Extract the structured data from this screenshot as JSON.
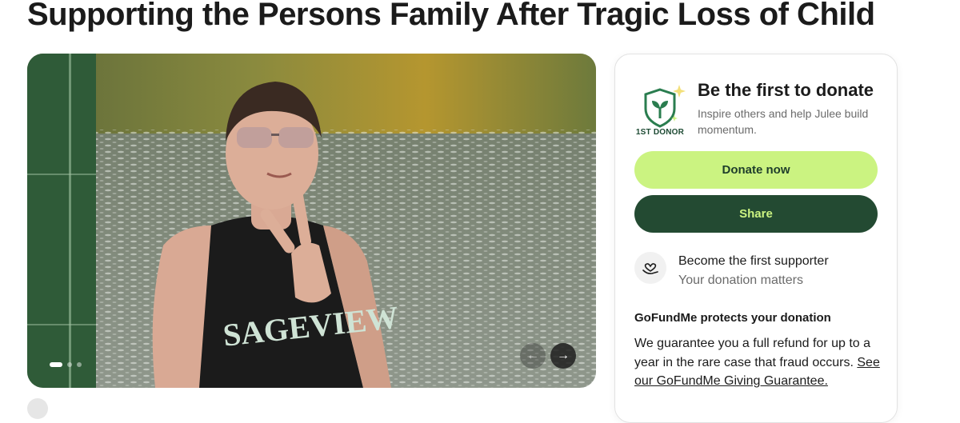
{
  "page": {
    "title": "Supporting the Persons Family After Tragic Loss of Child"
  },
  "hero": {
    "image_alt": "Teen in a SAGEVIEW tank top giving a peace sign by a river",
    "shirt_text": "SAGEVIEW",
    "prev_label": "←",
    "next_label": "→",
    "slide_current": 1
  },
  "donate_card": {
    "badge_label": "1ST DONOR",
    "heading": "Be the first to donate",
    "subtext": "Inspire others and help Julee build momentum.",
    "donate_button": "Donate now",
    "share_button": "Share",
    "supporter_title": "Become the first supporter",
    "supporter_sub": "Your donation matters",
    "protect_title": "GoFundMe protects your donation",
    "protect_text": "We guarantee you a full refund for up to a year in the rare case that fraud occurs.",
    "protect_link": "See our GoFundMe Giving Guarantee."
  },
  "colors": {
    "accent_light": "#cbf381",
    "accent_dark": "#234a32"
  },
  "icons": {
    "badge": "shield-sprout-icon",
    "supporter": "heart-hand-icon",
    "prev": "arrow-left-icon",
    "next": "arrow-right-icon"
  }
}
